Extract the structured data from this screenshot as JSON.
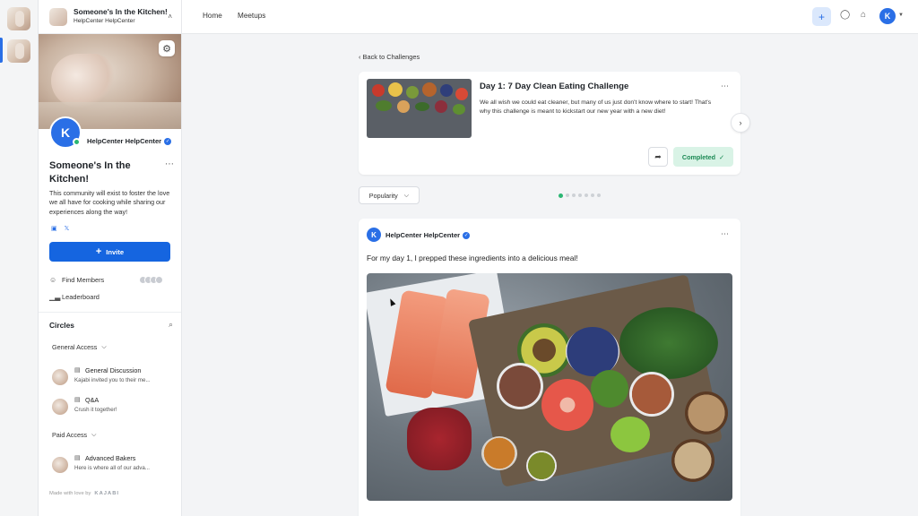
{
  "community": {
    "name": "Someone's In the Kitchen!",
    "owner_short": "HelpCenter HelpCenter",
    "owner_name": "HelpCenter HelpCenter",
    "description": "This community will exist to foster the love we all have for cooking while sharing our experiences along the way!",
    "invite_label": "Invite",
    "find_members_label": "Find Members",
    "leaderboard_label": "Leaderboard"
  },
  "circles": {
    "title": "Circles",
    "groups": [
      {
        "label": "General Access",
        "items": [
          {
            "name": "General Discussion",
            "preview": "Kajabi invited you to their me..."
          },
          {
            "name": "Q&A",
            "preview": "Crush it together!"
          }
        ]
      },
      {
        "label": "Paid Access",
        "items": [
          {
            "name": "Advanced Bakers",
            "preview": "Here is where all of our adva..."
          }
        ]
      }
    ]
  },
  "footer": {
    "made_with": "Made with love by",
    "brand": "KAJABI"
  },
  "nav": {
    "home": "Home",
    "meetups": "Meetups"
  },
  "main": {
    "back_label": "Back to Challenges",
    "challenge": {
      "title": "Day 1: 7 Day Clean Eating Challenge",
      "description": "We all wish we could eat cleaner, but many of us just don't know where to start! That's why this challenge is meant to kickstart our new year with a new diet!",
      "completed_label": "Completed"
    },
    "sort_label": "Popularity",
    "pager": {
      "total": 7,
      "active": 1
    },
    "post": {
      "author": "HelpCenter HelpCenter",
      "text": "For my day 1, I prepped these ingredients into a delicious meal!"
    }
  },
  "colors": {
    "accent": "#1565e0",
    "success": "#2bb673",
    "completed_bg": "#d9f3e6"
  },
  "icons": [
    "gear-icon",
    "chevron-up-icon",
    "more-icon",
    "instagram-icon",
    "twitter-icon",
    "plus-icon",
    "user-icon",
    "leaderboard-icon",
    "search-icon",
    "chevron-down-icon",
    "post-icon",
    "chevron-left-icon",
    "share-icon",
    "check-icon",
    "chevron-right-icon",
    "chat-icon",
    "bell-icon",
    "verified-icon"
  ]
}
